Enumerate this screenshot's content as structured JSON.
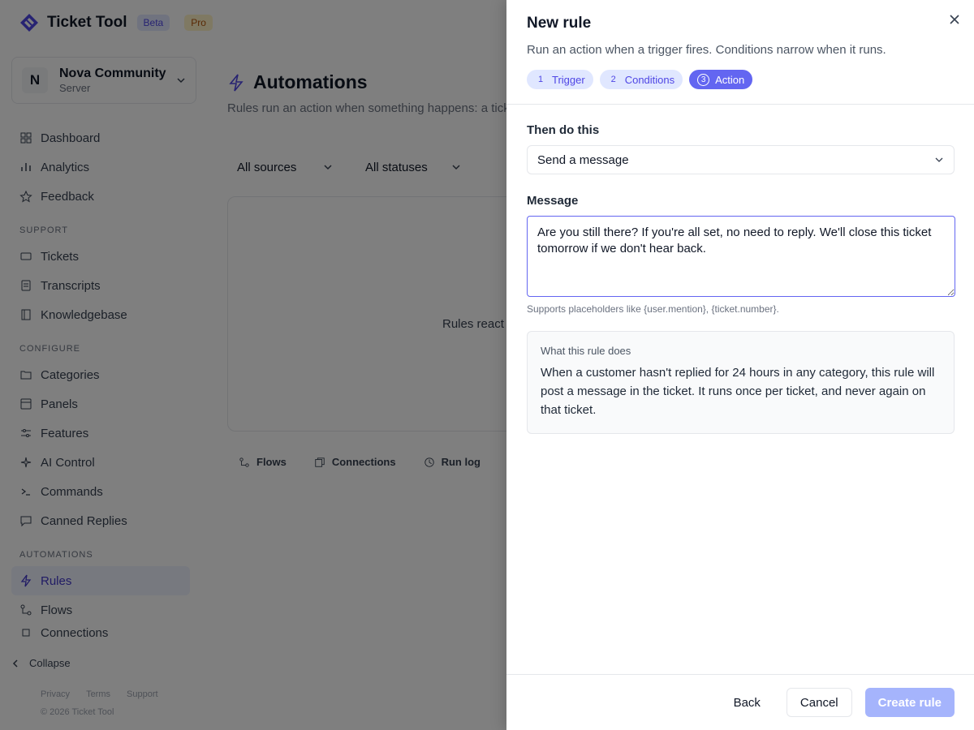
{
  "app": {
    "brand": "Ticket Tool",
    "badge_beta": "Beta",
    "badge_pro": "Pro",
    "server": {
      "initial": "N",
      "name": "Nova Community",
      "type": "Server"
    },
    "nav_top": [
      "Dashboard",
      "Analytics",
      "Feedback"
    ],
    "section_support": "SUPPORT",
    "nav_support": [
      "Tickets",
      "Transcripts",
      "Knowledgebase"
    ],
    "section_configure": "CONFIGURE",
    "nav_configure": [
      "Categories",
      "Panels",
      "Features",
      "AI Control",
      "Commands",
      "Canned Replies"
    ],
    "section_automations": "AUTOMATIONS",
    "nav_automations": [
      "Rules",
      "Flows",
      "Connections"
    ],
    "collapse": "Collapse",
    "footer_links": [
      "Privacy",
      "Terms",
      "Support"
    ],
    "copyright": "© 2026 Ticket Tool",
    "page_title": "Automations",
    "page_subtitle": "Rules run an action when something happens: a ticket",
    "filter_sources": "All sources",
    "filter_statuses": "All statuses",
    "empty_text": "Rules react to",
    "tabs": [
      "Flows",
      "Connections",
      "Run log"
    ]
  },
  "drawer": {
    "title": "New rule",
    "subtitle": "Run an action when a trigger fires. Conditions narrow when it runs.",
    "steps": [
      {
        "num": "1",
        "label": "Trigger"
      },
      {
        "num": "2",
        "label": "Conditions"
      },
      {
        "num": "3",
        "label": "Action"
      }
    ],
    "action_label": "Then do this",
    "action_value": "Send a message",
    "message_label": "Message",
    "message_value": "Are you still there? If you're all set, no need to reply. We'll close this ticket tomorrow if we don't hear back.",
    "hint": "Supports placeholders like {user.mention}, {ticket.number}.",
    "summary_title": "What this rule does",
    "summary_text": "When a customer hasn't replied for 24 hours in any category, this rule will post a message in the ticket. It runs once per ticket, and never again on that ticket.",
    "back": "Back",
    "cancel": "Cancel",
    "create": "Create rule"
  }
}
